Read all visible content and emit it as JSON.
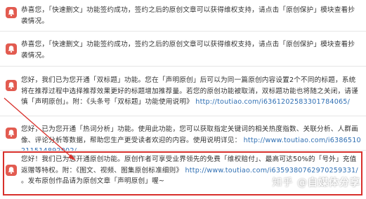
{
  "notifications": [
    {
      "text": "恭喜您，「快速删文」功能签约成功，签约之后的原创文章可以获得维权支持，请点击「原创保护」模块查看抄袭情况。",
      "link": ""
    },
    {
      "text": "恭喜您，「快速删文」功能签约成功，签约之后的原创文章可以获得维权支持，请点击「原创保护」模块查看抄袭情况。",
      "link": ""
    },
    {
      "text": "您好，我们已为您开通「双标题」功能。您在「声明原创」后可以为同一篇原创内容设置2个不同的标题，系统将在推荐过程中选择推荐效果更好的标题增加推荐量。若您的原创功能被取消，双标题功能也将随之关闭，请谨慎「声明原创」。附：《头条号「双标题」功能使用说明》",
      "link": "http://toutiao.com/i6361202583301784065/"
    },
    {
      "text": "您好，已为您开通「热词分析」功能。使用此功能，您可以获取指定关键词的相关热度指数、关联分析、人群画像、评论分析等数据，帮助您生产更受读者欢迎的内容。使用说明详见：",
      "link": "http://www.toutiao.com/i6386510211514892802/"
    },
    {
      "text": "您好！我们已为您开通原创功能。原创作者可享受业界领先的免费「维权赔付」、最高可达50%的「号外」充值返赠等特权。附：《图文、视频、图集原创标准细则》",
      "link": "http://www.toutiao.com/i6359380762970259331/",
      "tail": "。发布原创作品请为原创文章「声明原创」喔~"
    }
  ],
  "watermark": {
    "prefix": "知乎 @",
    "name": "自媒体分享"
  },
  "colors": {
    "bell": "#e25b50",
    "link": "#2f6fb3",
    "highlight": "#d8302b"
  },
  "icons": [
    "bell-icon"
  ]
}
